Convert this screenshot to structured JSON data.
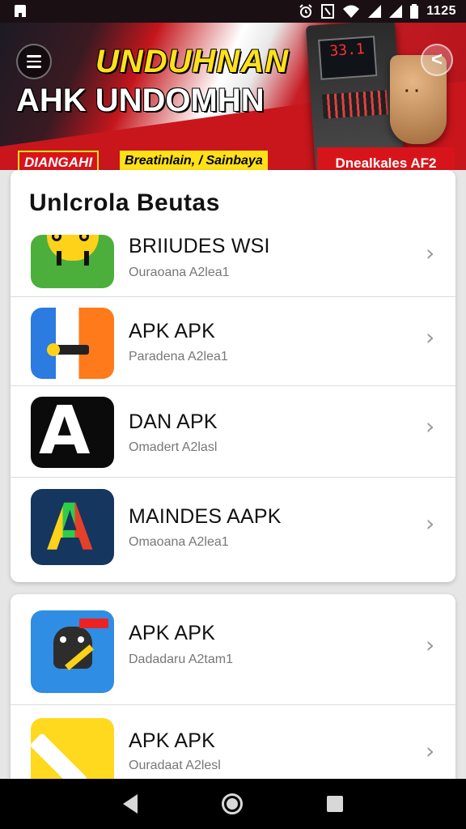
{
  "status_bar": {
    "time": "1125",
    "icons": [
      "app-notification-icon",
      "alarm-icon",
      "nfc-icon",
      "wifi-icon",
      "signal-icon",
      "signal-icon",
      "battery-icon"
    ]
  },
  "banner": {
    "headline_top": "UNDUHNAN",
    "headline_main": "AHK UNDOMHN",
    "tag_red": "DIANGAHI",
    "tag_yellow": "Breatinlain, / Sainbaya",
    "tag_right": "Dnealkales AF2",
    "device_display": "33.1"
  },
  "section1": {
    "title": "Unlcrola Beutas",
    "items": [
      {
        "name": "BRIIUDES WSI",
        "sub": "Ouraoana A2lea1",
        "icon": "smiley-app-icon"
      },
      {
        "name": "APK APK",
        "sub": "Paradena A2lea1",
        "icon": "a-letter-app-icon"
      },
      {
        "name": "DAN APK",
        "sub": "Omadert A2lasl",
        "icon": "a-letter-app-icon"
      },
      {
        "name": "MAINDES AAPK",
        "sub": "Omaoana A2lea1",
        "icon": "a-letter-app-icon"
      }
    ]
  },
  "section2": {
    "items": [
      {
        "name": "APK APK",
        "sub": "Dadadaru A2tam1",
        "icon": "android-robot-icon"
      },
      {
        "name": "APK APK",
        "sub": "Ouradaat A2lesl",
        "icon": "ruler-app-icon"
      }
    ]
  },
  "nav": {
    "back": "back-icon",
    "home": "home-icon",
    "recent": "recent-apps-icon"
  },
  "colors": {
    "accent_red": "#d8141b",
    "accent_yellow": "#ffe11a",
    "chevron": "#9a9a9a"
  }
}
